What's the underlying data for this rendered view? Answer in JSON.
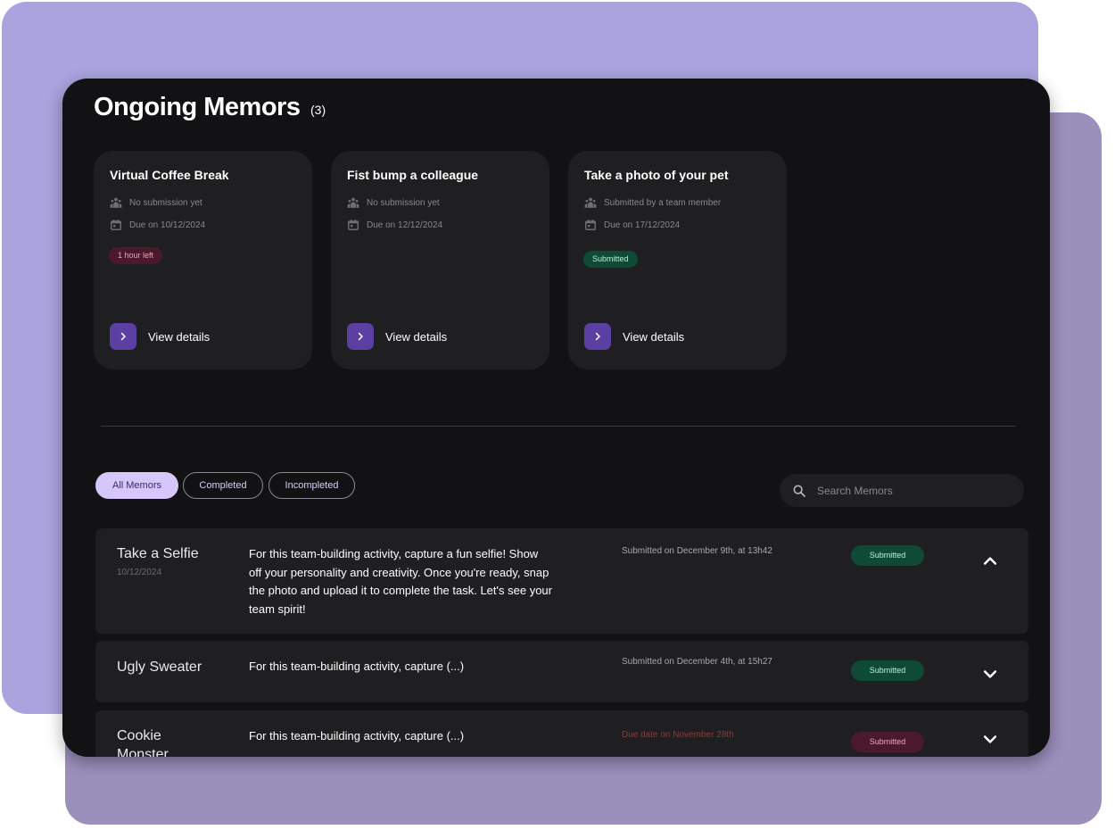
{
  "header": {
    "title": "Ongoing Memors",
    "count": "(3)"
  },
  "cards": [
    {
      "title": "Virtual Coffee Break",
      "submission": "No submission yet",
      "due": "Due on 10/12/2024",
      "badge": "1 hour left",
      "badge_color": "#4a1a2c",
      "view": "View details"
    },
    {
      "title": "Fist bump a colleague",
      "submission": "No submission yet",
      "due": "Due on 12/12/2024",
      "badge": "",
      "view": "View details"
    },
    {
      "title": "Take a photo of your pet",
      "submission": "Submitted by a team member",
      "due": "Due on 17/12/2024",
      "badge": "Submitted",
      "badge_color": "#0e4a36",
      "view": "View details"
    }
  ],
  "filters": {
    "all": "All Memors",
    "completed": "Completed",
    "incompleted": "Incompleted",
    "active": "All Memors"
  },
  "search": {
    "placeholder": "Search Memors"
  },
  "rows": [
    {
      "title": "Take a Selfie",
      "date": "10/12/2024",
      "description": "For this team-building activity, capture a fun selfie! Show off your personality and creativity. Once you're ready, snap the photo and upload it to complete the task. Let's see your team spirit!",
      "submitted": "Submitted on December 9th, at 13h42",
      "status": "Submitted",
      "expanded": true
    },
    {
      "title": "Ugly Sweater",
      "date": "",
      "description": "For this team-building activity, capture (...)",
      "submitted": "Submitted on December 4th, at 15h27",
      "status": "Submitted",
      "expanded": false
    },
    {
      "title": "Cookie Monster",
      "date": "",
      "description": "For this team-building activity, capture (...)",
      "submitted": "Due date on November 28th",
      "status": "Submitted",
      "expanded": false
    }
  ],
  "colors": {
    "accent": "#5b3fa3",
    "success": "#0e4a36",
    "danger": "#4a1a2c",
    "active_filter": "#d7c6fb"
  }
}
